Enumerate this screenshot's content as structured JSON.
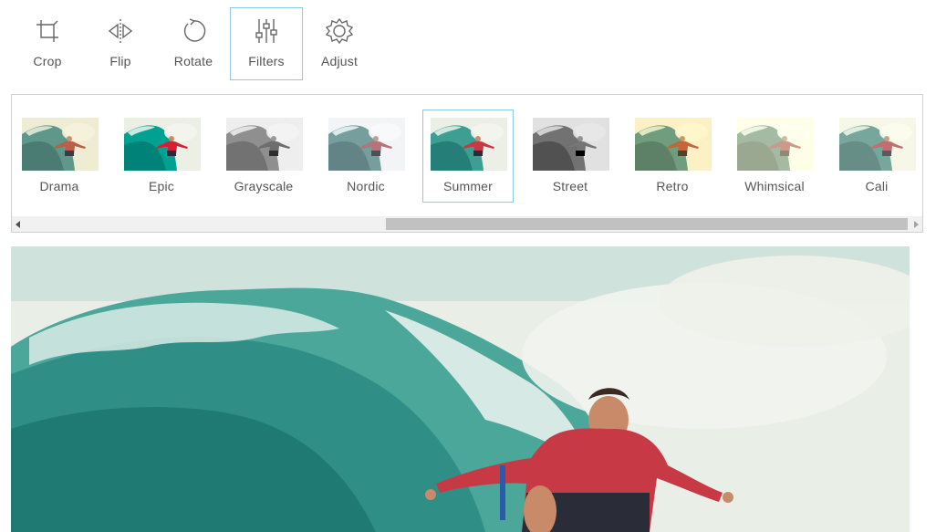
{
  "toolbar": {
    "tools": [
      {
        "label": "Crop",
        "icon": "crop-icon"
      },
      {
        "label": "Flip",
        "icon": "flip-icon"
      },
      {
        "label": "Rotate",
        "icon": "rotate-icon"
      },
      {
        "label": "Filters",
        "icon": "filters-icon",
        "active": true
      },
      {
        "label": "Adjust",
        "icon": "adjust-icon"
      }
    ]
  },
  "filters": {
    "selected": "Summer",
    "items": [
      {
        "label": "Drama"
      },
      {
        "label": "Epic"
      },
      {
        "label": "Grayscale"
      },
      {
        "label": "Nordic"
      },
      {
        "label": "Summer"
      },
      {
        "label": "Street"
      },
      {
        "label": "Retro"
      },
      {
        "label": "Whimsical"
      },
      {
        "label": "Cali"
      }
    ]
  },
  "colors": {
    "accent_border": "#8ccbe3",
    "label_text": "#555555"
  }
}
